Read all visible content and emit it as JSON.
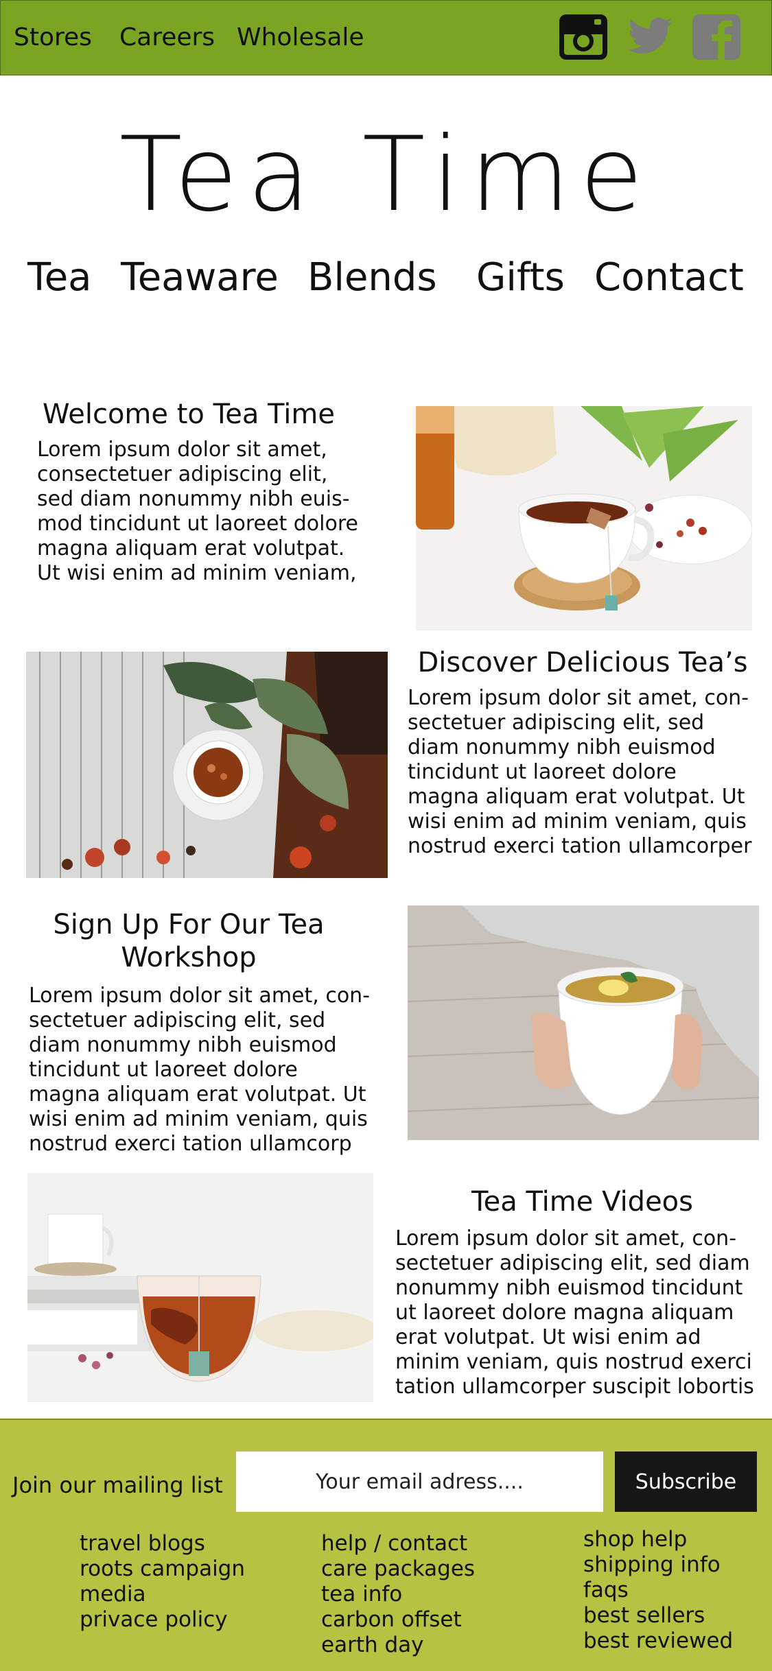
{
  "topbar": {
    "links": [
      "Stores",
      "Careers",
      "Wholesale"
    ],
    "social": [
      "instagram-icon",
      "twitter-icon",
      "facebook-icon"
    ],
    "color": "#7aa522"
  },
  "brand": {
    "title": "Tea Time"
  },
  "nav": [
    "Tea",
    "Teaware",
    "Blends",
    "Gifts",
    "Contact"
  ],
  "sections": [
    {
      "heading": "Welcome to Tea Time",
      "lines": [
        "Lorem ipsum dolor sit amet,",
        "consectetuer adipiscing elit,",
        "sed diam nonummy nibh euis-",
        "mod tincidunt ut laoreet dolore",
        "magna aliquam erat volutpat.",
        "Ut wisi enim ad minim veniam,"
      ]
    },
    {
      "heading": "Discover Delicious Tea’s",
      "lines": [
        "Lorem ipsum dolor sit amet, con-",
        "sectetuer adipiscing elit, sed",
        "diam nonummy nibh euismod",
        "tincidunt ut laoreet dolore",
        "magna aliquam erat volutpat. Ut",
        "wisi enim ad minim veniam, quis",
        "nostrud exerci tation ullamcorper"
      ]
    },
    {
      "heading": "Sign Up For Our Tea Workshop",
      "lines": [
        "Lorem ipsum dolor sit amet, con-",
        "sectetuer adipiscing elit, sed",
        "diam nonummy nibh euismod",
        "tincidunt ut laoreet dolore",
        "magna aliquam erat volutpat. Ut",
        "wisi enim ad minim veniam, quis",
        "nostrud exerci tation ullamcorp"
      ]
    },
    {
      "heading": "Tea Time Videos",
      "lines": [
        "Lorem ipsum dolor sit amet, con-",
        "sectetuer adipiscing elit, sed diam",
        "nonummy nibh euismod tincidunt",
        "ut laoreet dolore magna aliquam",
        "erat volutpat. Ut wisi enim ad",
        "minim veniam, quis nostrud exerci",
        "tation ullamcorper suscipit lobortis"
      ]
    }
  ],
  "footer": {
    "mailing_label": "Join our mailing list",
    "email_placeholder": "Your email adress....",
    "subscribe_label": "Subscribe",
    "col1": [
      "travel blogs",
      "roots campaign",
      "media",
      "privace policy"
    ],
    "col2": [
      "help / contact",
      "care packages",
      "tea info",
      "carbon offset",
      "earth day"
    ],
    "col3": [
      "shop help",
      "shipping info",
      "faqs",
      "best sellers",
      "best reviewed"
    ],
    "color": "#b7c142"
  }
}
